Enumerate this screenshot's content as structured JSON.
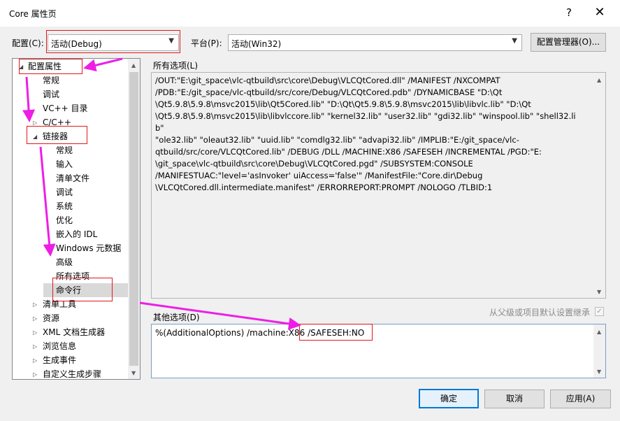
{
  "window": {
    "title": "Core 属性页",
    "help_glyph": "?",
    "close_glyph": "✕"
  },
  "config": {
    "label": "配置(C):",
    "value": "活动(Debug)",
    "platform_label": "平台(P):",
    "platform_value": "活动(Win32)",
    "manager_button": "配置管理器(O)..."
  },
  "tree": {
    "items": [
      {
        "label": "配置属性",
        "toggle": "◢",
        "level": 0
      },
      {
        "label": "常规",
        "toggle": "",
        "level": 1
      },
      {
        "label": "调试",
        "toggle": "",
        "level": 1
      },
      {
        "label": "VC++ 目录",
        "toggle": "",
        "level": 1
      },
      {
        "label": "C/C++",
        "toggle": "▷",
        "level": 1
      },
      {
        "label": "链接器",
        "toggle": "◢",
        "level": 1
      },
      {
        "label": "常规",
        "toggle": "",
        "level": 2
      },
      {
        "label": "输入",
        "toggle": "",
        "level": 2
      },
      {
        "label": "清单文件",
        "toggle": "",
        "level": 2
      },
      {
        "label": "调试",
        "toggle": "",
        "level": 2
      },
      {
        "label": "系统",
        "toggle": "",
        "level": 2
      },
      {
        "label": "优化",
        "toggle": "",
        "level": 2
      },
      {
        "label": "嵌入的 IDL",
        "toggle": "",
        "level": 2
      },
      {
        "label": "Windows 元数据",
        "toggle": "",
        "level": 2
      },
      {
        "label": "高级",
        "toggle": "",
        "level": 2
      },
      {
        "label": "所有选项",
        "toggle": "",
        "level": 2
      },
      {
        "label": "命令行",
        "toggle": "",
        "level": 2,
        "selected": true
      },
      {
        "label": "清单工具",
        "toggle": "▷",
        "level": 1
      },
      {
        "label": "资源",
        "toggle": "▷",
        "level": 1
      },
      {
        "label": "XML 文档生成器",
        "toggle": "▷",
        "level": 1
      },
      {
        "label": "浏览信息",
        "toggle": "▷",
        "level": 1
      },
      {
        "label": "生成事件",
        "toggle": "▷",
        "level": 1
      },
      {
        "label": "自定义生成步骤",
        "toggle": "▷",
        "level": 1
      }
    ]
  },
  "all_options": {
    "label": "所有选项(L)",
    "lines": [
      "/OUT:\"E:\\git_space\\vlc-qtbuild\\src\\core\\Debug\\VLCQtCored.dll\" /MANIFEST /NXCOMPAT",
      "/PDB:\"E:/git_space/vlc-qtbuild/src/core/Debug/VLCQtCored.pdb\" /DYNAMICBASE \"D:\\Qt",
      "\\Qt5.9.8\\5.9.8\\msvc2015\\lib\\Qt5Cored.lib\" \"D:\\Qt\\Qt5.9.8\\5.9.8\\msvc2015\\lib\\libvlc.lib\" \"D:\\Qt",
      "\\Qt5.9.8\\5.9.8\\msvc2015\\lib\\libvlccore.lib\" \"kernel32.lib\" \"user32.lib\" \"gdi32.lib\" \"winspool.lib\" \"shell32.lib\"",
      "\"ole32.lib\" \"oleaut32.lib\" \"uuid.lib\" \"comdlg32.lib\" \"advapi32.lib\" /IMPLIB:\"E:/git_space/vlc-",
      "qtbuild/src/core/VLCQtCored.lib\" /DEBUG /DLL /MACHINE:X86 /SAFESEH /INCREMENTAL /PGD:\"E:",
      "\\git_space\\vlc-qtbuild\\src\\core\\Debug\\VLCQtCored.pgd\" /SUBSYSTEM:CONSOLE",
      "/MANIFESTUAC:\"level='asInvoker' uiAccess='false'\" /ManifestFile:\"Core.dir\\Debug",
      "\\VLCQtCored.dll.intermediate.manifest\" /ERRORREPORT:PROMPT /NOLOGO /TLBID:1"
    ]
  },
  "inherit": {
    "label": "从父级或项目默认设置继承",
    "checked_glyph": "✓"
  },
  "other_options": {
    "label": "其他选项(D)",
    "value_prefix": "%(AdditionalOptions) /machine:X86 ",
    "value_added": "/SAFESEH:NO"
  },
  "buttons": {
    "ok": "确定",
    "cancel": "取消",
    "apply": "应用(A)"
  },
  "colors": {
    "annotation_red": "#e0181c",
    "annotation_magenta": "#ee1ee6",
    "selection": "#cce8ff",
    "focus_blue": "#0078d7"
  }
}
